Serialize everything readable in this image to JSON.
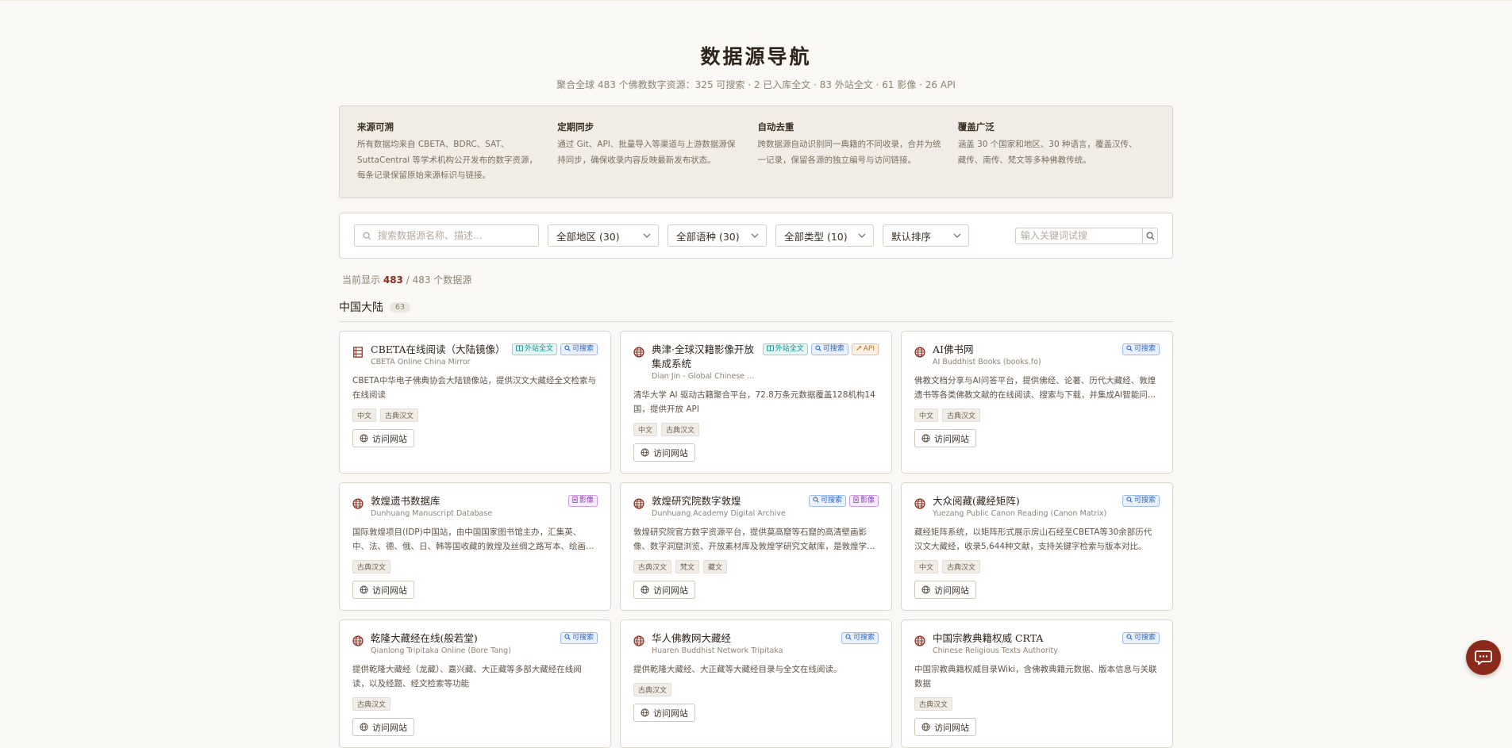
{
  "header": {
    "title": "数据源导航",
    "subtitle": "聚合全球 483 个佛教数字资源：325 可搜索 · 2 已入库全文 · 83 外站全文 · 61 影像 · 26 API"
  },
  "features": [
    {
      "title": "来源可溯",
      "desc": "所有数据均来自 CBETA、BDRC、SAT、SuttaCentral 等学术机构公开发布的数字资源，每条记录保留原始来源标识与链接。"
    },
    {
      "title": "定期同步",
      "desc": "通过 Git、API、批量导入等渠道与上游数据源保持同步，确保收录内容反映最新发布状态。"
    },
    {
      "title": "自动去重",
      "desc": "跨数据源自动识别同一典籍的不同收录，合并为统一记录，保留各源的独立编号与访问链接。"
    },
    {
      "title": "覆盖广泛",
      "desc": "涵盖 30 个国家和地区、30 种语言，覆盖汉传、藏传、南传、梵文等多种佛教传统。"
    }
  ],
  "filters": {
    "search_placeholder": "搜索数据源名称、描述...",
    "region": "全部地区 (30)",
    "language": "全部语种 (30)",
    "type": "全部类型 (10)",
    "sort": "默认排序",
    "keyword_placeholder": "输入关键词试搜"
  },
  "result": {
    "prefix": "当前显示",
    "shown": "483",
    "suffix": "/ 483 个数据源"
  },
  "region": {
    "title": "中国大陆",
    "count": "63"
  },
  "visit_label": "访问网站",
  "colors": {
    "accent": "#8b2a1a",
    "background": "#faf8f4"
  },
  "cards": [
    {
      "icon": "book-icon",
      "title": "CBETA在线阅读（大陆镜像）",
      "subtitle": "CBETA Online China Mirror",
      "badges": [
        {
          "kind": "fulltext",
          "label": "外站全文"
        },
        {
          "kind": "search",
          "label": "可搜索"
        }
      ],
      "desc": "CBETA中华电子佛典协会大陆镜像站，提供汉文大藏经全文检索与在线阅读",
      "tags": [
        "中文",
        "古典汉文"
      ]
    },
    {
      "icon": "globe-icon",
      "title": "典津·全球汉籍影像开放集成系统",
      "subtitle": "Dian Jin - Global Chinese Cl...",
      "badges": [
        {
          "kind": "fulltext",
          "label": "外站全文"
        },
        {
          "kind": "search",
          "label": "可搜索"
        },
        {
          "kind": "api",
          "label": "API"
        }
      ],
      "desc": "清华大学 AI 驱动古籍聚合平台，72.8万条元数据覆盖128机构14国，提供开放 API",
      "tags": [
        "中文",
        "古典汉文"
      ]
    },
    {
      "icon": "globe-icon",
      "title": "AI佛书网",
      "subtitle": "AI Buddhist Books (books.fo)",
      "badges": [
        {
          "kind": "search",
          "label": "可搜索"
        }
      ],
      "desc": "佛教文档分享与AI问答平台，提供佛经、论著、历代大藏经、敦煌遗书等各类佛教文献的在线阅读、搜索与下载，并集成AI智能问答功能",
      "tags": [
        "中文",
        "古典汉文"
      ]
    },
    {
      "icon": "globe-icon",
      "title": "敦煌遗书数据库",
      "subtitle": "Dunhuang Manuscript Database",
      "badges": [
        {
          "kind": "image",
          "label": "影像"
        }
      ],
      "desc": "国际敦煌项目(IDP)中国站，由中国国家图书馆主办，汇集英、中、法、德、俄、日、韩等国收藏的敦煌及丝绸之路写本、绘画等文物的高清影像",
      "tags": [
        "古典汉文"
      ]
    },
    {
      "icon": "globe-icon",
      "title": "敦煌研究院数字敦煌",
      "subtitle": "Dunhuang Academy Digital Archive",
      "badges": [
        {
          "kind": "search",
          "label": "可搜索"
        },
        {
          "kind": "image",
          "label": "影像"
        }
      ],
      "desc": "敦煌研究院官方数字资源平台，提供莫高窟等石窟的高清壁画影像、数字洞窟浏览、开放素材库及敦煌学研究文献库，是敦煌学研究的重要资源",
      "tags": [
        "古典汉文",
        "梵文",
        "藏文"
      ]
    },
    {
      "icon": "globe-icon",
      "title": "大众阅藏(藏经矩阵)",
      "subtitle": "Yuezang Public Canon Reading (Canon Matrix)",
      "badges": [
        {
          "kind": "search",
          "label": "可搜索"
        }
      ],
      "desc": "藏经矩阵系统，以矩阵形式展示房山石经至CBETA等30余部历代汉文大藏经，收录5,644种文献，支持关键字检索与版本对比。",
      "tags": [
        "中文",
        "古典汉文"
      ]
    },
    {
      "icon": "globe-icon",
      "title": "乾隆大藏经在线(般若堂)",
      "subtitle": "Qianlong Tripitaka Online (Bore Tang)",
      "badges": [
        {
          "kind": "search",
          "label": "可搜索"
        }
      ],
      "desc": "提供乾隆大藏经（龙藏）、嘉兴藏、大正藏等多部大藏经在线阅读，以及经题、经文检索等功能",
      "tags": [
        "古典汉文"
      ]
    },
    {
      "icon": "globe-icon",
      "title": "华人佛教网大藏经",
      "subtitle": "Huaren Buddhist Network Tripitaka",
      "badges": [
        {
          "kind": "search",
          "label": "可搜索"
        }
      ],
      "desc": "提供乾隆大藏经、大正藏等大藏经目录与全文在线阅读。",
      "tags": [
        "古典汉文"
      ]
    },
    {
      "icon": "globe-icon",
      "title": "中国宗教典籍权威 CRTA",
      "subtitle": "Chinese Religious Texts Authority",
      "badges": [
        {
          "kind": "search",
          "label": "可搜索"
        }
      ],
      "desc": "中国宗教典籍权威目录Wiki，含佛教典籍元数据、版本信息与关联数据",
      "tags": [
        "古典汉文"
      ]
    }
  ]
}
